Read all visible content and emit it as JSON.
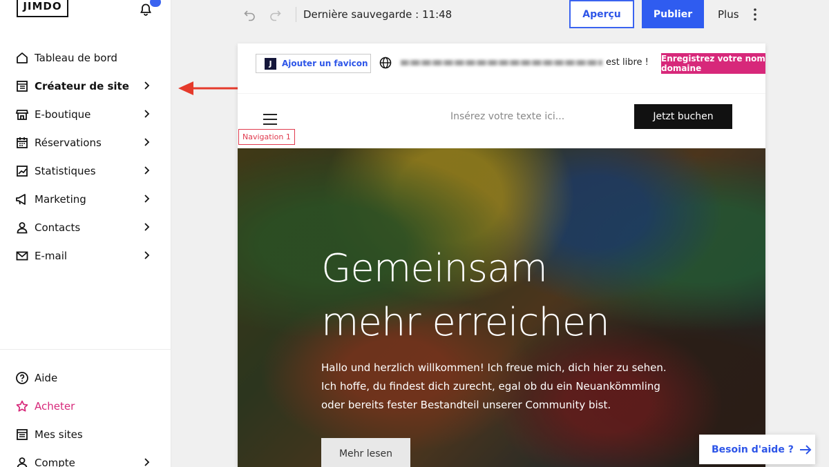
{
  "brand": {
    "logo_text": "JIMDO"
  },
  "sidebar": {
    "items": [
      {
        "label": "Tableau de bord",
        "icon": "home-icon",
        "chevron": false
      },
      {
        "label": "Créateur de site",
        "icon": "layout-icon",
        "chevron": true,
        "active": true
      },
      {
        "label": "E-boutique",
        "icon": "store-icon",
        "chevron": true
      },
      {
        "label": "Réservations",
        "icon": "calendar-icon",
        "chevron": true
      },
      {
        "label": "Statistiques",
        "icon": "chart-icon",
        "chevron": true
      },
      {
        "label": "Marketing",
        "icon": "megaphone-icon",
        "chevron": true
      },
      {
        "label": "Contacts",
        "icon": "person-icon",
        "chevron": true
      },
      {
        "label": "E-mail",
        "icon": "mail-icon",
        "chevron": true
      }
    ],
    "bottom_items": [
      {
        "label": "Aide",
        "icon": "help-icon",
        "chevron": false
      },
      {
        "label": "Acheter",
        "icon": "star-icon",
        "chevron": false
      },
      {
        "label": "Mes sites",
        "icon": "sites-icon",
        "chevron": false
      },
      {
        "label": "Compte",
        "icon": "person-icon",
        "chevron": true
      }
    ]
  },
  "topbar": {
    "save_status": "Dernière sauvegarde : 11:48",
    "preview_label": "Aperçu",
    "publish_label": "Publier",
    "more_label": "Plus"
  },
  "preview": {
    "favicon_label": "Ajouter un favicon",
    "favicon_badge": "J",
    "domain_status": "est libre !",
    "register_domain_label": "Enregistrez votre nom de domaine",
    "header_text": "Insérez votre texte ici...",
    "book_label": "Jetzt buchen",
    "nav_label": "Navigation 1",
    "hero_title_line1": "Gemeinsam",
    "hero_title_line2": "mehr erreichen",
    "hero_text_line1": "Hallo und herzlich willkommen! Ich freue mich, dich hier zu sehen.",
    "hero_text_line2": "Ich hoffe, du findest dich zurecht, egal ob du ein Neuankömmling",
    "hero_text_line3": "oder bereits fester Bestandteil unserer Community bist.",
    "more_label": "Mehr lesen"
  },
  "help_button": {
    "label": "Besoin d'aide ?"
  },
  "colors": {
    "accent_blue": "#2f5cf0",
    "accent_pink": "#d7287a",
    "annotation_red": "#e53a2b"
  }
}
